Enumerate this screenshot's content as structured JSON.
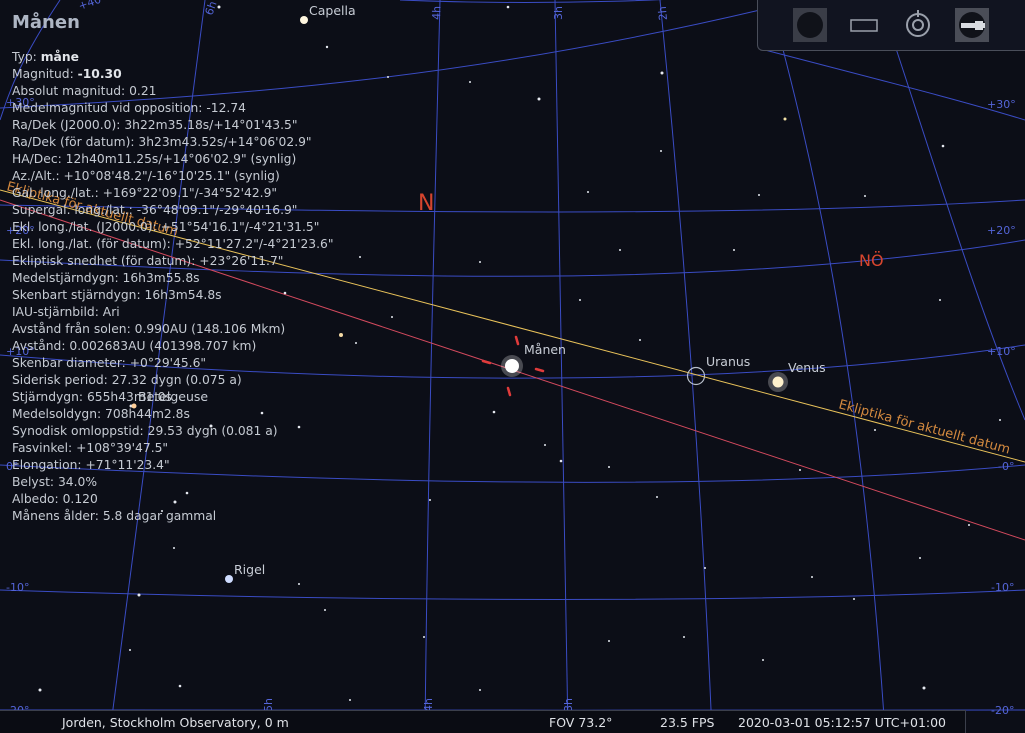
{
  "object": {
    "name": "Månen",
    "info_lines": [
      {
        "label": "Typ: ",
        "value": "måne",
        "bold": true
      },
      {
        "label": "Magnitud: ",
        "value": "-10.30",
        "bold": true
      },
      {
        "label": "Absolut magnitud: ",
        "value": "0.21"
      },
      {
        "label": "Medelmagnitud vid opposition: ",
        "value": "-12.74"
      },
      {
        "label": "Ra/Dek (J2000.0): ",
        "value": "3h22m35.18s/+14°01'43.5\""
      },
      {
        "label": "Ra/Dek (för datum): ",
        "value": "3h23m43.52s/+14°06'02.9\""
      },
      {
        "label": "HA/Dec: ",
        "value": "12h40m11.25s/+14°06'02.9\" (synlig)"
      },
      {
        "label": "Az./Alt.: ",
        "value": "+10°08'48.2\"/-16°10'25.1\" (synlig)"
      },
      {
        "label": "Gal. long./lat.: ",
        "value": "+169°22'09.1\"/-34°52'42.9\""
      },
      {
        "label": "Supergal. long./lat.: ",
        "value": "-36°48'09.1\"/-29°40'16.9\""
      },
      {
        "label": "Ekl. long./lat. (J2000.0): ",
        "value": "+51°54'16.1\"/-4°21'31.5\""
      },
      {
        "label": "Ekl. long./lat. (för datum): ",
        "value": "+52°11'27.2\"/-4°21'23.6\""
      },
      {
        "label": "Ekliptisk snedhet (för datum): ",
        "value": "+23°26'11.7\""
      },
      {
        "label": "Medelstjärndygn: ",
        "value": "16h3m55.8s"
      },
      {
        "label": "Skenbart stjärndygn: ",
        "value": "16h3m54.8s"
      },
      {
        "label": "IAU-stjärnbild: ",
        "value": "Ari"
      },
      {
        "label": "Avstånd från solen: ",
        "value": "0.990AU (148.106 Mkm)"
      },
      {
        "label": "Avstånd: ",
        "value": "0.002683AU (401398.707 km)"
      },
      {
        "label": "Skenbar diameter: ",
        "value": "+0°29'45.6\""
      },
      {
        "label": "Siderisk period: ",
        "value": "27.32 dygn (0.075 a)"
      },
      {
        "label": "Stjärndygn: ",
        "value": "655h43m1.0s"
      },
      {
        "label": "Medelsoldygn: ",
        "value": "708h44m2.8s"
      },
      {
        "label": "Synodisk omloppstid: ",
        "value": "29.53 dygn (0.081 a)"
      },
      {
        "label": "Fasvinkel: ",
        "value": "+108°39'47.5\""
      },
      {
        "label": "Elongation: ",
        "value": "+71°11'23.4\""
      },
      {
        "label": "Belyst: ",
        "value": "34.0%"
      },
      {
        "label": "Albedo: ",
        "value": "0.120"
      },
      {
        "label": "Månens ålder: ",
        "value": "5.8 dagar gammal"
      }
    ]
  },
  "sky_labels": {
    "capella": "Capella",
    "manen": "Månen",
    "uranus": "Uranus",
    "venus": "Venus",
    "rigel": "Rigel",
    "betelgeuse": "Betelgeuse",
    "cardinal_n": "N",
    "cardinal_no": "NÖ",
    "ecliptic_1": "Ekliptika för aktuellt datum",
    "ecliptic_2": "Ekliptika för aktuellt datum"
  },
  "grid_labels": {
    "ra_top": [
      "6h",
      "4h",
      "3h",
      "2h",
      "1h"
    ],
    "ra_bottom": [
      "5h",
      "4h",
      "3h"
    ],
    "dec_left": [
      "+40°",
      "+30°",
      "+20°",
      "+10°",
      "0°",
      "-10°",
      "-20°"
    ],
    "dec_right": [
      "+30°",
      "+20°",
      "+10°",
      "-0°",
      "-10°",
      "-20°"
    ]
  },
  "toolbar": {
    "icons": [
      "moon-icon",
      "window-icon",
      "target-icon",
      "telescope-icon"
    ]
  },
  "status": {
    "location": "Jorden, Stockholm Observatory, 0 m",
    "fov": "FOV 73.2°",
    "fps": "23.5 FPS",
    "datetime": "2020-03-01 05:12:57 UTC+01:00"
  },
  "colors": {
    "grid": "#3a4cc4",
    "ecliptic": "#e9c25a",
    "ecliptic_label": "#d3893f",
    "equator": "#d44a5e",
    "cardinal": "#d6452e",
    "reticle": "#e03b3b"
  }
}
